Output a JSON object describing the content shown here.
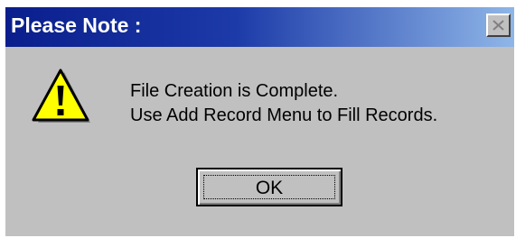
{
  "window": {
    "title": "Please Note :",
    "close_icon": "close-icon"
  },
  "content": {
    "icon": "warning-icon",
    "message_line1": "File Creation is Complete.",
    "message_line2": "Use Add Record Menu to Fill Records."
  },
  "buttons": {
    "ok_label": "OK"
  },
  "colors": {
    "title_bar_start": "#0a1e8c",
    "title_bar_end": "#8fb6e8",
    "dialog_bg": "#c0c0c0",
    "warning_fill": "#ffff00"
  }
}
